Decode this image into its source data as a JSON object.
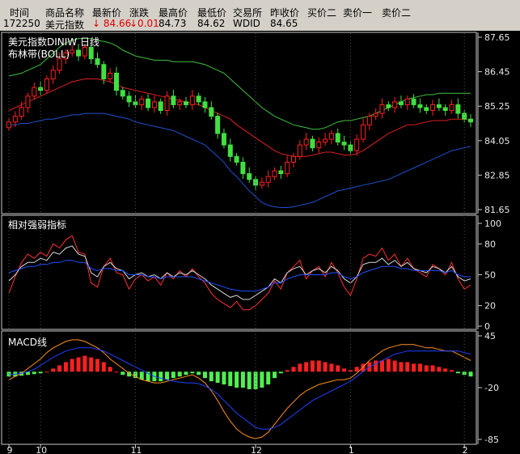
{
  "quote": {
    "headers": [
      "时间",
      "商品名称",
      "最新价",
      "涨跌",
      "最高价",
      "最低价",
      "交易所",
      "昨收价",
      "买价二",
      "卖价一",
      "卖价二"
    ],
    "values": [
      "172250",
      "美元指数",
      "↓ 84.66",
      "↓0.01",
      "84.73",
      "84.62",
      "WDID",
      "84.65",
      "",
      "",
      ""
    ],
    "colors": {
      "down": "#e00000"
    }
  },
  "chart_data": [
    {
      "type": "candlestick",
      "title": "美元指数DINIW  日线",
      "indicator_label": "布林带(BOLL)",
      "yticks": [
        "87.65",
        "86.45",
        "85.25",
        "84.05",
        "82.85",
        "81.65"
      ],
      "ylim": [
        81.65,
        87.65
      ],
      "xticks": [
        "9",
        "10",
        "11",
        "12",
        "1",
        "2"
      ],
      "xtick_index": [
        0,
        5,
        20,
        39,
        54,
        72
      ],
      "colors": {
        "up": "#ff2020",
        "down": "#40e040",
        "mid": "#e02020",
        "upper": "#40c040",
        "lower": "#2050d0"
      },
      "closes": [
        84.7,
        84.9,
        85.2,
        85.6,
        85.9,
        85.8,
        86.2,
        86.5,
        86.9,
        87.1,
        87.2,
        87.0,
        87.3,
        86.9,
        86.7,
        86.2,
        86.4,
        85.8,
        85.6,
        85.4,
        85.3,
        85.5,
        85.2,
        85.4,
        85.1,
        85.6,
        85.3,
        85.4,
        85.3,
        85.6,
        85.4,
        85.2,
        84.9,
        84.3,
        83.9,
        83.5,
        83.3,
        82.9,
        82.7,
        82.5,
        82.6,
        82.8,
        83.0,
        82.9,
        83.3,
        83.5,
        83.9,
        84.1,
        83.8,
        84.0,
        84.1,
        84.3,
        84.0,
        83.9,
        83.7,
        84.1,
        84.6,
        84.9,
        85.0,
        85.3,
        85.2,
        85.4,
        85.3,
        85.5,
        85.3,
        85.2,
        85.1,
        85.3,
        85.2,
        85.1,
        85.3,
        85.0,
        84.8,
        84.7
      ],
      "upper": [
        86.3,
        86.35,
        86.4,
        86.5,
        86.6,
        86.7,
        86.9,
        87.1,
        87.3,
        87.45,
        87.55,
        87.6,
        87.62,
        87.6,
        87.55,
        87.5,
        87.45,
        87.35,
        87.2,
        87.1,
        87.0,
        86.95,
        86.9,
        86.85,
        86.85,
        86.85,
        86.8,
        86.8,
        86.8,
        86.8,
        86.75,
        86.7,
        86.6,
        86.5,
        86.4,
        86.2,
        86.0,
        85.8,
        85.6,
        85.4,
        85.2,
        85.05,
        84.9,
        84.8,
        84.7,
        84.6,
        84.55,
        84.5,
        84.45,
        84.45,
        84.5,
        84.6,
        84.7,
        84.75,
        84.75,
        84.8,
        84.85,
        84.9,
        85.0,
        85.1,
        85.2,
        85.3,
        85.4,
        85.5,
        85.55,
        85.6,
        85.65,
        85.65,
        85.7,
        85.7,
        85.7,
        85.7,
        85.7,
        85.7
      ],
      "mid": [
        85.1,
        85.2,
        85.3,
        85.4,
        85.5,
        85.6,
        85.7,
        85.8,
        85.9,
        86.0,
        86.1,
        86.15,
        86.2,
        86.2,
        86.2,
        86.15,
        86.1,
        86.0,
        85.9,
        85.85,
        85.8,
        85.75,
        85.7,
        85.65,
        85.6,
        85.55,
        85.5,
        85.45,
        85.4,
        85.35,
        85.3,
        85.2,
        85.1,
        85.0,
        84.9,
        84.8,
        84.6,
        84.45,
        84.3,
        84.15,
        84.0,
        83.85,
        83.7,
        83.6,
        83.55,
        83.5,
        83.5,
        83.5,
        83.55,
        83.6,
        83.65,
        83.65,
        83.6,
        83.55,
        83.55,
        83.6,
        83.7,
        83.85,
        84.0,
        84.15,
        84.3,
        84.4,
        84.5,
        84.6,
        84.6,
        84.65,
        84.7,
        84.75,
        84.75,
        84.75,
        84.8,
        84.8,
        84.8,
        84.75
      ],
      "lower": [
        84.6,
        84.6,
        84.65,
        84.65,
        84.7,
        84.75,
        84.8,
        84.8,
        84.85,
        84.9,
        84.95,
        84.95,
        85.0,
        85.0,
        85.0,
        85.0,
        84.95,
        84.9,
        84.85,
        84.8,
        84.7,
        84.65,
        84.6,
        84.55,
        84.5,
        84.45,
        84.4,
        84.3,
        84.2,
        84.1,
        84.0,
        83.9,
        83.7,
        83.5,
        83.3,
        83.0,
        82.8,
        82.55,
        82.3,
        82.1,
        81.9,
        81.8,
        81.75,
        81.72,
        81.72,
        81.75,
        81.8,
        81.85,
        81.9,
        82.0,
        82.1,
        82.2,
        82.3,
        82.35,
        82.4,
        82.45,
        82.5,
        82.55,
        82.6,
        82.65,
        82.7,
        82.8,
        82.9,
        83.0,
        83.1,
        83.2,
        83.3,
        83.4,
        83.5,
        83.6,
        83.7,
        83.75,
        83.8,
        83.85
      ]
    },
    {
      "type": "line",
      "title": "相对强弱指标",
      "yticks": [
        "100",
        "80",
        "50",
        "20",
        "0"
      ],
      "ylim": [
        0,
        100
      ],
      "series": [
        {
          "key": "rsi6",
          "color": "#ff3030",
          "values": [
            32,
            48,
            62,
            70,
            66,
            72,
            68,
            80,
            76,
            84,
            88,
            72,
            70,
            42,
            38,
            58,
            66,
            52,
            50,
            36,
            46,
            50,
            44,
            48,
            40,
            52,
            46,
            54,
            48,
            56,
            48,
            42,
            32,
            26,
            22,
            18,
            24,
            16,
            16,
            20,
            26,
            32,
            44,
            36,
            52,
            58,
            64,
            46,
            54,
            58,
            48,
            62,
            52,
            38,
            30,
            46,
            66,
            70,
            68,
            76,
            64,
            70,
            58,
            66,
            56,
            52,
            48,
            60,
            56,
            50,
            62,
            46,
            36,
            40
          ]
        },
        {
          "key": "rsi12",
          "color": "#d8d8d8",
          "values": [
            44,
            50,
            58,
            62,
            62,
            66,
            64,
            72,
            70,
            76,
            78,
            70,
            68,
            52,
            48,
            58,
            62,
            56,
            54,
            46,
            50,
            52,
            48,
            50,
            46,
            52,
            48,
            52,
            50,
            54,
            50,
            46,
            40,
            36,
            32,
            28,
            30,
            26,
            26,
            30,
            34,
            38,
            46,
            42,
            52,
            56,
            58,
            50,
            54,
            56,
            52,
            58,
            54,
            46,
            42,
            48,
            60,
            62,
            62,
            66,
            60,
            64,
            58,
            62,
            56,
            54,
            52,
            58,
            56,
            52,
            58,
            48,
            44,
            46
          ]
        },
        {
          "key": "rsi24",
          "color": "#2050ff",
          "values": [
            52,
            54,
            56,
            58,
            58,
            60,
            60,
            62,
            62,
            64,
            64,
            62,
            62,
            56,
            54,
            56,
            56,
            54,
            54,
            50,
            50,
            50,
            48,
            48,
            46,
            48,
            48,
            48,
            48,
            48,
            46,
            44,
            42,
            40,
            38,
            36,
            35,
            34,
            34,
            34,
            36,
            38,
            42,
            42,
            46,
            48,
            50,
            50,
            50,
            50,
            50,
            52,
            52,
            48,
            46,
            48,
            52,
            54,
            56,
            58,
            58,
            58,
            56,
            56,
            54,
            54,
            54,
            54,
            54,
            52,
            54,
            50,
            48,
            48
          ]
        }
      ]
    },
    {
      "type": "bar+line",
      "title": "MACD线",
      "yticks": [
        "45",
        "-20",
        "-85"
      ],
      "ylim": [
        -85,
        45
      ],
      "colors": {
        "pos": "#ff2020",
        "neg": "#50f050"
      },
      "hist": [
        -6,
        -6,
        -5,
        -4,
        -3,
        -2,
        0,
        4,
        8,
        12,
        16,
        18,
        20,
        18,
        16,
        12,
        6,
        0,
        -4,
        -6,
        -8,
        -10,
        -12,
        -12,
        -12,
        -10,
        -8,
        -6,
        -4,
        -2,
        -4,
        -8,
        -12,
        -14,
        -16,
        -18,
        -20,
        -20,
        -22,
        -22,
        -20,
        -16,
        -8,
        -2,
        2,
        6,
        10,
        12,
        14,
        14,
        12,
        10,
        8,
        4,
        2,
        6,
        10,
        12,
        14,
        14,
        16,
        14,
        12,
        12,
        10,
        10,
        8,
        8,
        6,
        4,
        2,
        -2,
        -4,
        -6
      ],
      "series": [
        {
          "key": "dif",
          "color": "#ff9020",
          "values": [
            -10,
            -6,
            -2,
            4,
            10,
            16,
            24,
            30,
            34,
            38,
            40,
            40,
            38,
            34,
            30,
            24,
            16,
            10,
            4,
            -2,
            -6,
            -10,
            -12,
            -14,
            -14,
            -12,
            -10,
            -8,
            -6,
            -4,
            -8,
            -14,
            -24,
            -36,
            -50,
            -62,
            -72,
            -78,
            -82,
            -84,
            -82,
            -76,
            -66,
            -56,
            -46,
            -38,
            -30,
            -24,
            -20,
            -16,
            -14,
            -12,
            -10,
            -10,
            -8,
            -2,
            6,
            14,
            20,
            26,
            30,
            32,
            34,
            34,
            34,
            32,
            30,
            30,
            28,
            26,
            26,
            22,
            18,
            14
          ]
        },
        {
          "key": "dea",
          "color": "#2040ff",
          "values": [
            -4,
            -3,
            -2,
            0,
            3,
            8,
            13,
            18,
            22,
            26,
            28,
            30,
            30,
            30,
            28,
            26,
            22,
            18,
            14,
            10,
            6,
            2,
            -2,
            -6,
            -8,
            -10,
            -12,
            -13,
            -14,
            -14,
            -15,
            -18,
            -22,
            -28,
            -36,
            -44,
            -52,
            -58,
            -64,
            -70,
            -72,
            -72,
            -70,
            -66,
            -60,
            -54,
            -48,
            -42,
            -36,
            -32,
            -28,
            -24,
            -20,
            -16,
            -12,
            -6,
            0,
            6,
            10,
            14,
            18,
            22,
            24,
            26,
            26,
            26,
            26,
            26,
            26,
            26,
            26,
            26,
            24,
            22
          ]
        }
      ]
    }
  ]
}
